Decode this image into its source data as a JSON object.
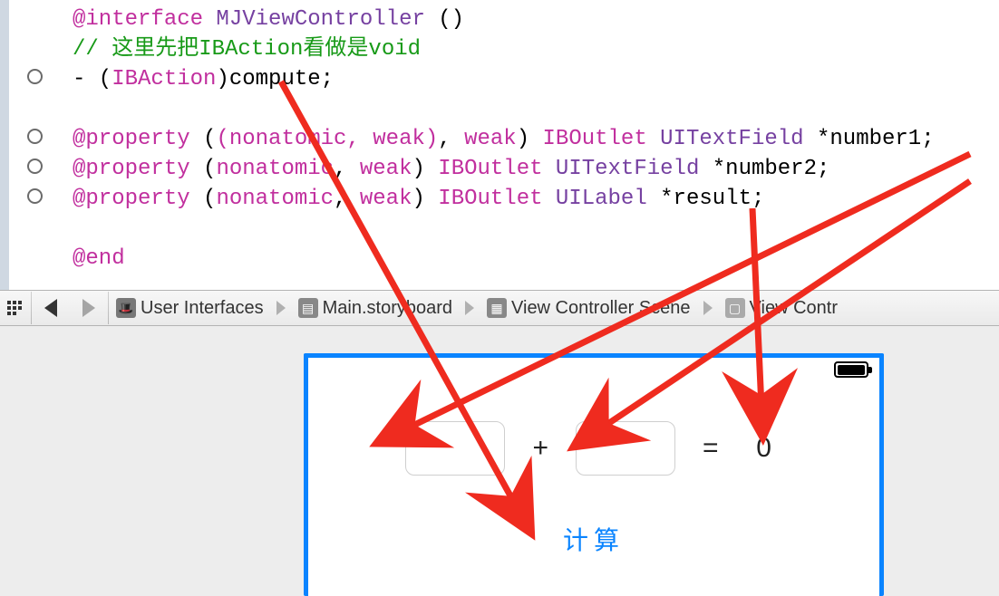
{
  "code": {
    "line1": {
      "kw": "@interface",
      "cls": " MJViewController",
      "rest": " ()"
    },
    "line2": "// 这里先把IBAction看做是void",
    "line3": {
      "pre": "- (",
      "ib": "IBAction",
      "post": ")compute;"
    },
    "props": [
      {
        "kw": "@property",
        "attrs": "(nonatomic, weak)",
        "iboutlet": "IBOutlet",
        "type": "UITextField",
        "name": "*number1;"
      },
      {
        "kw": "@property",
        "attrs": "(nonatomic, weak)",
        "iboutlet": "IBOutlet",
        "type": "UITextField",
        "name": "*number2;"
      },
      {
        "kw": "@property",
        "attrs": "(nonatomic, weak)",
        "iboutlet": "IBOutlet",
        "type": "UILabel",
        "name": "*result;"
      }
    ],
    "end": "@end"
  },
  "breadcrumb": {
    "items": [
      "User Interfaces",
      "Main.storyboard",
      "View Controller Scene",
      "View Contr"
    ]
  },
  "ui": {
    "plus": "+",
    "equals": "=",
    "result_default": "0",
    "compute_button": "计算"
  }
}
